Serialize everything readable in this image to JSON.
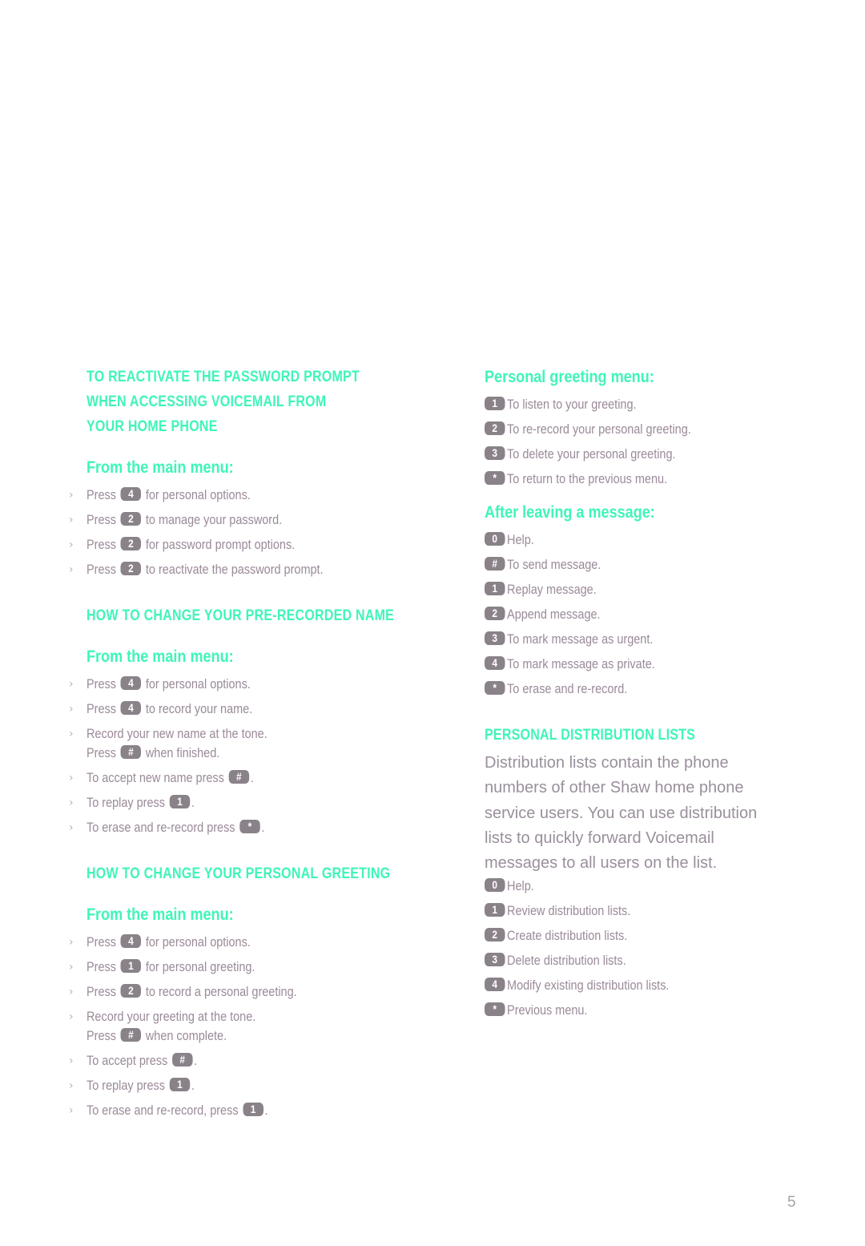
{
  "left": {
    "section1": {
      "title_lines": [
        "TO REACTIVATE THE PASSWORD PROMPT",
        "WHEN ACCESSING VOICEMAIL FROM",
        "YOUR HOME PHONE"
      ],
      "subheading": "From the main menu:",
      "steps": [
        {
          "pre": "Press",
          "key": "4",
          "post": "for personal options."
        },
        {
          "pre": "Press",
          "key": "2",
          "post": "to manage your password."
        },
        {
          "pre": "Press",
          "key": "2",
          "post": "for password prompt options."
        },
        {
          "pre": "Press",
          "key": "2",
          "post": "to reactivate the password prompt."
        }
      ]
    },
    "section2": {
      "title": "HOW TO CHANGE YOUR PRE-RECORDED NAME",
      "subheading": "From the main menu:",
      "steps": [
        {
          "pre": "Press",
          "key": "4",
          "post": "for personal options."
        },
        {
          "pre": "Press",
          "key": "4",
          "post": "to record your name."
        },
        {
          "line1": "Record your new name at the tone.",
          "pre": "Press",
          "key": "#",
          "post": "when finished."
        },
        {
          "pre": "To accept new name press",
          "key": "#",
          "post": "."
        },
        {
          "pre": "To replay press",
          "key": "1",
          "post": "."
        },
        {
          "pre": "To erase and re-record press",
          "key": "*",
          "post": "."
        }
      ]
    },
    "section3": {
      "title": "HOW TO CHANGE YOUR PERSONAL GREETING",
      "subheading": "From the main menu:",
      "steps": [
        {
          "pre": "Press",
          "key": "4",
          "post": "for personal options."
        },
        {
          "pre": "Press",
          "key": "1",
          "post": "for personal greeting."
        },
        {
          "pre": "Press",
          "key": "2",
          "post": "to record a personal greeting."
        },
        {
          "line1": "Record your greeting at the tone.",
          "pre": "Press",
          "key": "#",
          "post": "when complete."
        },
        {
          "pre": "To accept press",
          "key": "#",
          "post": "."
        },
        {
          "pre": "To replay press",
          "key": "1",
          "post": "."
        },
        {
          "pre": "To erase and re-record, press",
          "key": "1",
          "post": "."
        }
      ]
    }
  },
  "right": {
    "greeting_menu": {
      "heading": "Personal greeting menu:",
      "items": [
        {
          "key": "1",
          "text": "To listen to your greeting."
        },
        {
          "key": "2",
          "text": "To re-record your personal greeting."
        },
        {
          "key": "3",
          "text": "To delete your personal greeting."
        },
        {
          "key": "*",
          "text": "To return to the previous menu."
        }
      ]
    },
    "after_message": {
      "heading": "After leaving a message:",
      "items": [
        {
          "key": "0",
          "text": "Help."
        },
        {
          "key": "#",
          "text": "To send message."
        },
        {
          "key": "1",
          "text": "Replay message."
        },
        {
          "key": "2",
          "text": "Append message."
        },
        {
          "key": "3",
          "text": "To mark message as urgent."
        },
        {
          "key": "4",
          "text": "To mark message as private."
        },
        {
          "key": "*",
          "text": "To erase and re-record."
        }
      ]
    },
    "distribution": {
      "title": "PERSONAL DISTRIBUTION LISTS",
      "paragraph_lines": [
        "Distribution lists contain the phone",
        "numbers of other Shaw home phone",
        "service users. You can use distribution",
        "lists to quickly forward Voicemail",
        "messages to all users on the list."
      ],
      "items": [
        {
          "key": "0",
          "text": "Help."
        },
        {
          "key": "1",
          "text": "Review distribution lists."
        },
        {
          "key": "2",
          "text": "Create distribution lists."
        },
        {
          "key": "3",
          "text": "Delete distribution lists."
        },
        {
          "key": "4",
          "text": "Modify existing distribution lists."
        },
        {
          "key": "*",
          "text": "Previous menu."
        }
      ]
    }
  },
  "page_number": "5",
  "colors": {
    "heading": "#3ff5b8",
    "body": "#9a8a99",
    "key_badge": "#8a8289"
  }
}
